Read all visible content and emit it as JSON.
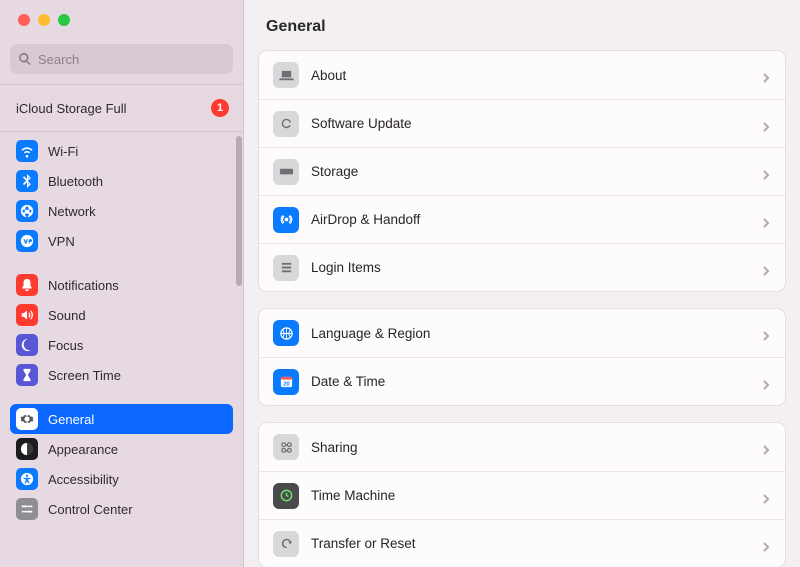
{
  "search": {
    "placeholder": "Search"
  },
  "storage_alert": {
    "label": "iCloud Storage Full",
    "badge": "1"
  },
  "sidebar": {
    "groups": [
      {
        "items": [
          {
            "label": "Wi-Fi",
            "icon": "wifi-icon"
          },
          {
            "label": "Bluetooth",
            "icon": "bluetooth-icon"
          },
          {
            "label": "Network",
            "icon": "globe-icon"
          },
          {
            "label": "VPN",
            "icon": "vpn-icon"
          }
        ]
      },
      {
        "items": [
          {
            "label": "Notifications",
            "icon": "bell-icon"
          },
          {
            "label": "Sound",
            "icon": "speaker-icon"
          },
          {
            "label": "Focus",
            "icon": "moon-icon"
          },
          {
            "label": "Screen Time",
            "icon": "hourglass-icon"
          }
        ]
      },
      {
        "items": [
          {
            "label": "General",
            "icon": "gear-icon",
            "selected": true
          },
          {
            "label": "Appearance",
            "icon": "appearance-icon"
          },
          {
            "label": "Accessibility",
            "icon": "accessibility-icon"
          },
          {
            "label": "Control Center",
            "icon": "sliders-icon"
          }
        ]
      }
    ]
  },
  "main": {
    "title": "General",
    "panels": [
      {
        "rows": [
          {
            "label": "About",
            "icon": "laptop-icon",
            "tone": "grey"
          },
          {
            "label": "Software Update",
            "icon": "gear-refresh-icon",
            "tone": "grey"
          },
          {
            "label": "Storage",
            "icon": "disk-icon",
            "tone": "grey"
          },
          {
            "label": "AirDrop & Handoff",
            "icon": "airdrop-icon",
            "tone": "blue"
          },
          {
            "label": "Login Items",
            "icon": "list-icon",
            "tone": "grey"
          }
        ]
      },
      {
        "rows": [
          {
            "label": "Language & Region",
            "icon": "globe-grid-icon",
            "tone": "blue"
          },
          {
            "label": "Date & Time",
            "icon": "calendar-icon",
            "tone": "blue"
          }
        ]
      },
      {
        "rows": [
          {
            "label": "Sharing",
            "icon": "share-icon",
            "tone": "grey"
          },
          {
            "label": "Time Machine",
            "icon": "clock-icon",
            "tone": "dark"
          },
          {
            "label": "Transfer or Reset",
            "icon": "refresh-icon",
            "tone": "grey"
          }
        ]
      }
    ]
  }
}
